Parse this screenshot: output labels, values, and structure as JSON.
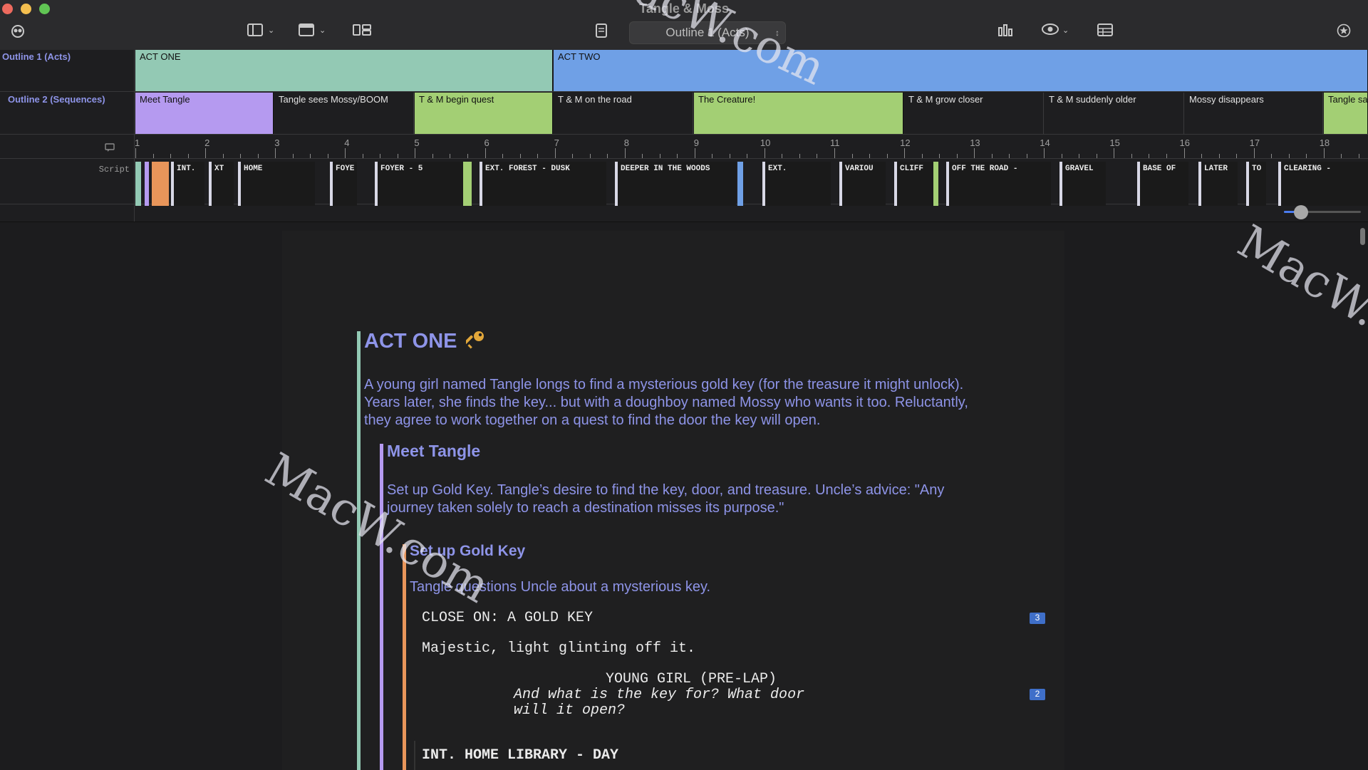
{
  "window": {
    "title": "Tangle & Moss"
  },
  "toolbar": {
    "outline_selector": "Outline 1 (Acts)"
  },
  "timeline": {
    "rows": {
      "outline1": "Outline 1 (Acts)",
      "outline2": "Outline 2 (Sequences)",
      "script": "Script"
    },
    "acts": [
      {
        "label": "ACT ONE",
        "color": "#93c9b4"
      },
      {
        "label": "ACT TWO",
        "color": "#6fa0e6"
      }
    ],
    "sequences": [
      {
        "label": "Meet Tangle",
        "color": "#b59af0"
      },
      {
        "label": "Tangle sees Mossy/BOOM",
        "color": ""
      },
      {
        "label": "T & M begin quest",
        "color": "#a3cf74"
      },
      {
        "label": "T & M on the road",
        "color": ""
      },
      {
        "label": "The Creature!",
        "color": "#a3cf74"
      },
      {
        "label": "T & M grow closer",
        "color": ""
      },
      {
        "label": "T & M suddenly older",
        "color": ""
      },
      {
        "label": "Mossy disappears",
        "color": ""
      },
      {
        "label": "Tangle sa",
        "color": "#a3cf74"
      }
    ],
    "ruler": [
      "1",
      "2",
      "3",
      "4",
      "5",
      "6",
      "7",
      "8",
      "9",
      "10",
      "11",
      "12",
      "13",
      "14",
      "15",
      "16",
      "17",
      "18"
    ],
    "scenes": [
      "INT.",
      "XT",
      "HOME",
      "FOYE",
      "FOYER - 5",
      "EXT. FOREST - DUSK",
      "DEEPER IN THE WOODS",
      "EXT.",
      "VARIOU",
      "CLIFF",
      "OFF THE ROAD -",
      "GRAVEL",
      "BASE OF",
      "LATER",
      "TO",
      "CLEARING -"
    ],
    "zoom_level": 0.22
  },
  "document": {
    "act_title": "ACT ONE",
    "act_icon": "key-icon",
    "act_summary": "A young girl named Tangle longs to find a mysterious gold key (for the treasure it might unlock). Years later, she finds the key... but with a doughboy named Mossy who wants it too. Reluctantly, they agree to work together on a quest to find the door the key will open.",
    "sequence_title": "Meet Tangle",
    "sequence_summary": "Set up Gold Key. Tangle’s desire to find the key, door, and treasure. Uncle’s advice: \"Any journey taken solely to reach a destination misses its purpose.\"",
    "scene_title": "Set up Gold Key",
    "scene_summary": "Tangle questions Uncle about a mysterious key.",
    "script": {
      "action1": "CLOSE ON: A GOLD KEY",
      "action1_notes": "3",
      "action2": "Majestic, light glinting off it.",
      "character": "YOUNG GIRL (PRE-LAP)",
      "dialogue1": "And what is the key for? What door",
      "dialogue2": "will it open?",
      "dialogue_notes": "2",
      "slugline": "INT. HOME LIBRARY - DAY"
    }
  },
  "watermark": "MacW.com",
  "colors": {
    "outline_text": "#8e94e8",
    "act_bar": "#93c9b4",
    "sequence_bar": "#b59af0",
    "scene_bar": "#e8955a",
    "accent": "#4b7cf0"
  }
}
